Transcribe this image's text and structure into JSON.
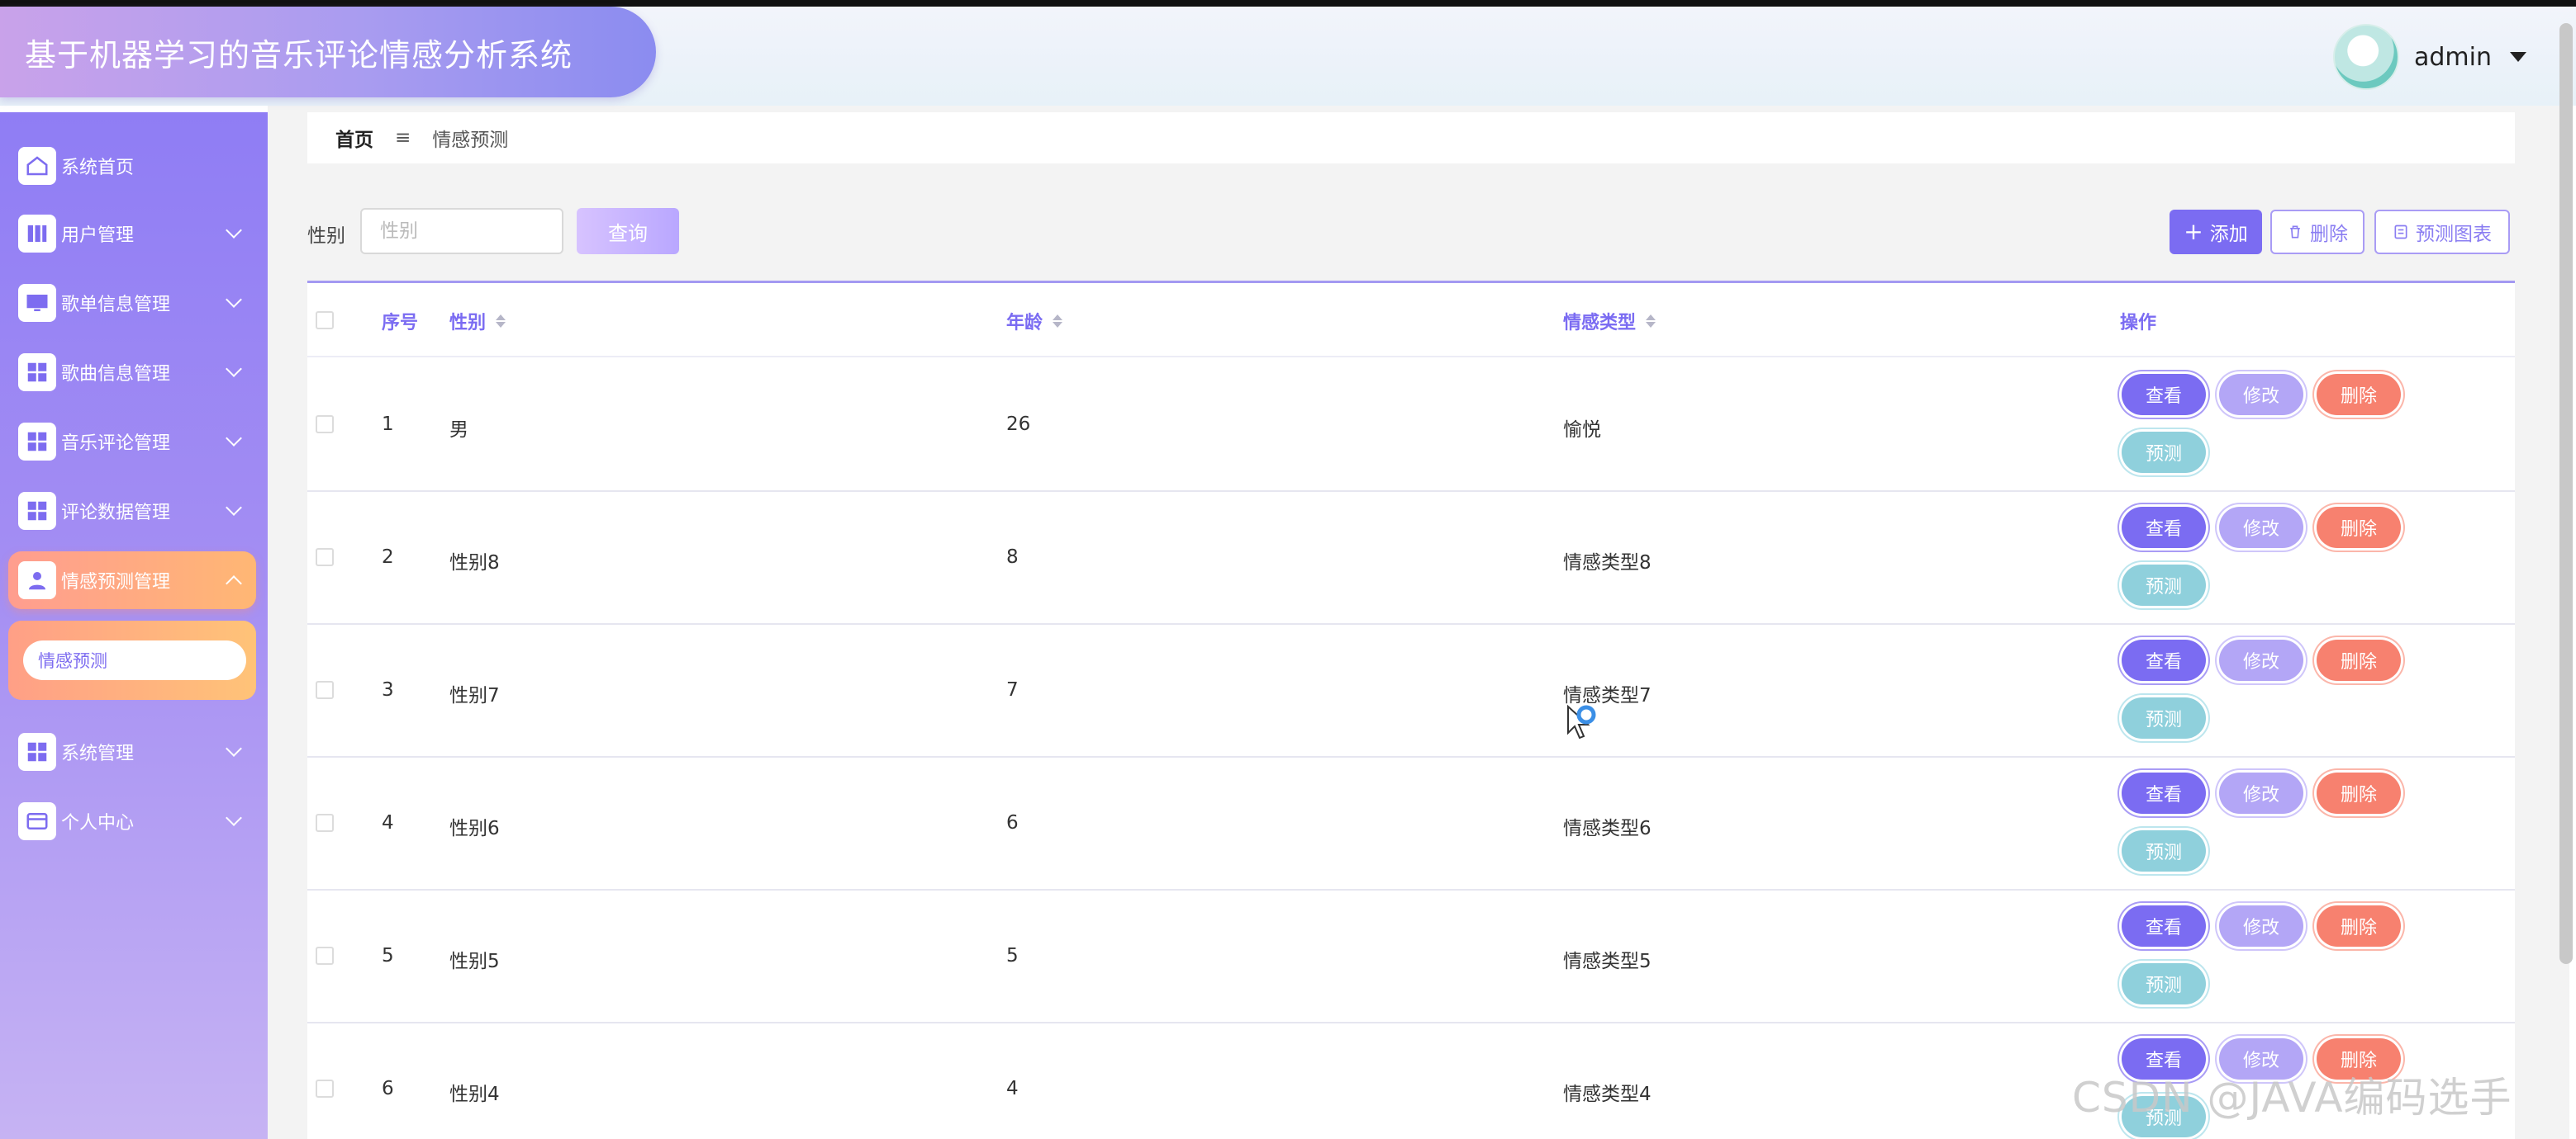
{
  "app": {
    "title": "基于机器学习的音乐评论情感分析系统"
  },
  "user": {
    "name": "admin"
  },
  "sidebar": {
    "items": [
      {
        "label": "系统首页",
        "icon": "home-icon"
      },
      {
        "label": "用户管理",
        "icon": "book-icon"
      },
      {
        "label": "歌单信息管理",
        "icon": "monitor-icon"
      },
      {
        "label": "歌曲信息管理",
        "icon": "grid-icon"
      },
      {
        "label": "音乐评论管理",
        "icon": "grid-icon"
      },
      {
        "label": "评论数据管理",
        "icon": "grid-icon"
      },
      {
        "label": "情感预测管理",
        "icon": "user-icon",
        "active": true
      },
      {
        "label": "系统管理",
        "icon": "grid-icon"
      },
      {
        "label": "个人中心",
        "icon": "wallet-icon"
      }
    ],
    "sub_items": [
      {
        "label": "情感预测"
      }
    ]
  },
  "breadcrumb": {
    "home": "首页",
    "separator": "≡",
    "current": "情感预测"
  },
  "search": {
    "label": "性别",
    "placeholder": "性别",
    "query_button": "查询"
  },
  "toolbar": {
    "add": "添加",
    "delete": "删除",
    "chart": "预测图表"
  },
  "table": {
    "columns": [
      "序号",
      "性别",
      "年龄",
      "情感类型",
      "操作"
    ],
    "rows": [
      {
        "index": "1",
        "gender": "男",
        "age": "26",
        "emotion": "愉悦"
      },
      {
        "index": "2",
        "gender": "性别8",
        "age": "8",
        "emotion": "情感类型8"
      },
      {
        "index": "3",
        "gender": "性别7",
        "age": "7",
        "emotion": "情感类型7"
      },
      {
        "index": "4",
        "gender": "性别6",
        "age": "6",
        "emotion": "情感类型6"
      },
      {
        "index": "5",
        "gender": "性别5",
        "age": "5",
        "emotion": "情感类型5"
      },
      {
        "index": "6",
        "gender": "性别4",
        "age": "4",
        "emotion": "情感类型4"
      }
    ],
    "actions": {
      "view": "查看",
      "edit": "修改",
      "delete": "删除",
      "predict": "预测"
    }
  },
  "watermark": "CSDN @JAVA编码选手",
  "colors": {
    "primary": "#7b6cf2",
    "edit": "#b3a6f6",
    "danger": "#f7816f",
    "predict": "#8fd0dc",
    "active_nav": "#ffa97f"
  }
}
